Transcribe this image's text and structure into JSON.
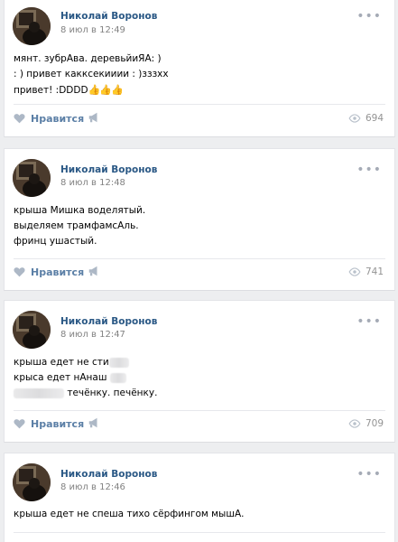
{
  "posts": [
    {
      "author": "Николай Воронов",
      "date": "8 июл в 12:49",
      "lines": [
        "мянт. зубрАва. деревьйиЯА: )",
        ": ) привет какксекииии : )зззхх",
        "привет! :DDDD"
      ],
      "like_label": "Нравится",
      "views": "694"
    },
    {
      "author": "Николай Воронов",
      "date": "8 июл в 12:48",
      "lines": [
        "крыша Мишка воделятый.",
        "выделяем трамфамсАль.",
        "фринц ушастый."
      ],
      "like_label": "Нравится",
      "views": "741"
    },
    {
      "author": "Николай Воронов",
      "date": "8 июл в 12:47",
      "lines": [
        "крыша едет не сти",
        "крыса едет нАнаш",
        "течёнку. печёнку."
      ],
      "like_label": "Нравится",
      "views": "709"
    },
    {
      "author": "Николай Воронов",
      "date": "8 июл в 12:46",
      "lines": [
        "крыша едет не спеша тихо сёрфингом мышА."
      ]
    }
  ],
  "icons": {
    "heart": "heart-icon",
    "share": "megaphone-share-icon",
    "views": "eye-icon",
    "more": "more-dots-icon"
  },
  "colors": {
    "author_link": "#2a5885",
    "action_label": "#5b7fa6",
    "icon": "#adb8c6",
    "meta": "#828282",
    "background": "#edeef0"
  }
}
